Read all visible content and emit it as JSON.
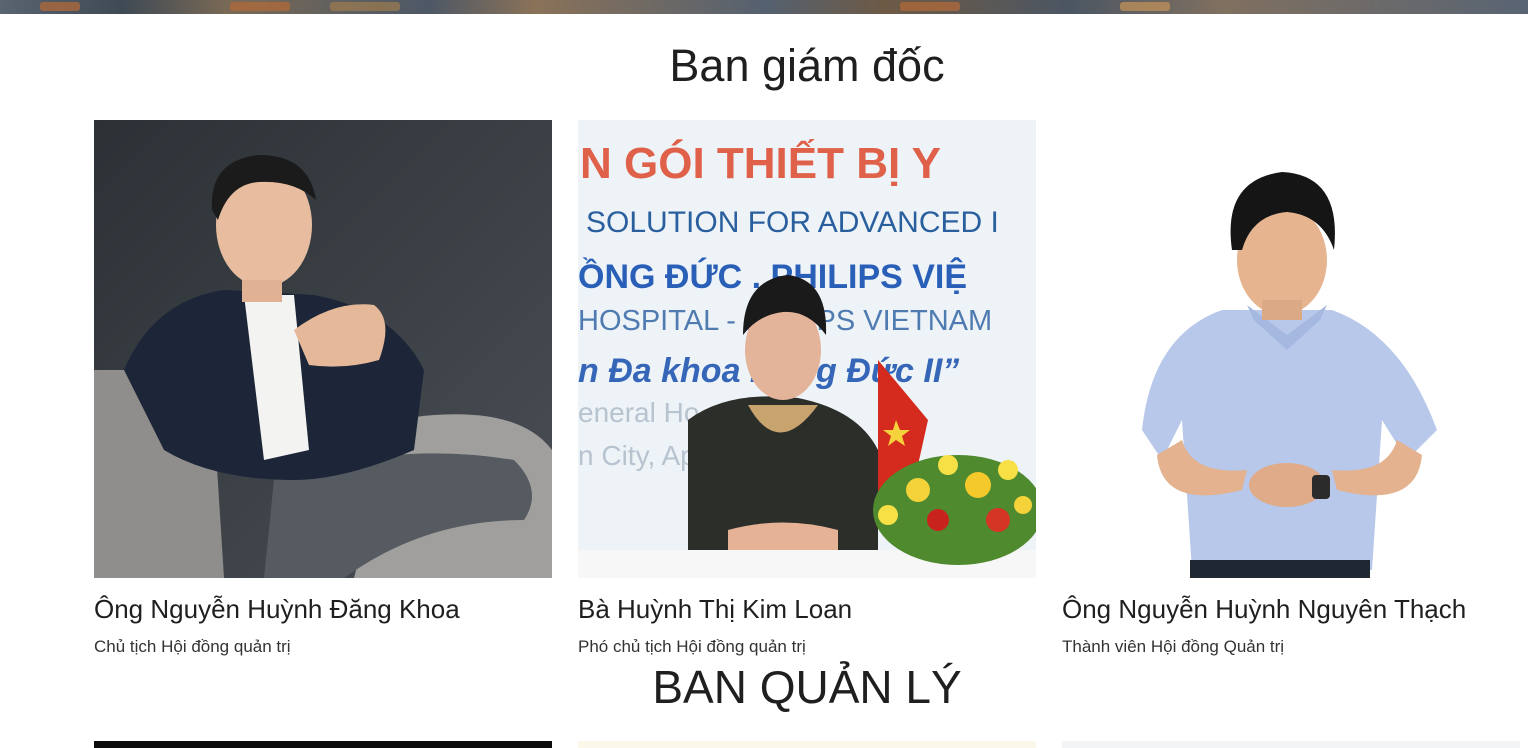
{
  "sections": {
    "directors_title": "Ban giám đốc",
    "management_title": "BAN QUẢN LÝ"
  },
  "directors": [
    {
      "name": "Ông Nguyễn Huỳnh Đăng Khoa",
      "role": "Chủ tịch Hội đồng quản trị"
    },
    {
      "name": "Bà Huỳnh Thị Kim Loan",
      "role": "Phó chủ tịch Hội đồng quản trị"
    },
    {
      "name": "Ông Nguyễn Huỳnh Nguyên Thạch",
      "role": "Thành viên Hội đồng Quản trị"
    }
  ],
  "photo2_banner": {
    "line1": "N GÓI THIẾT BỊ Y",
    "line2": "SOLUTION FOR ADVANCED I",
    "line3": "ỒNG ĐỨC . PHILIPS VIỆ",
    "line4": "HOSPITAL - PHILIPS VIETNAM",
    "line5": "n Đa khoa Hồng Đức II”",
    "line6": "eneral Ho",
    "line7": "n City, Ap"
  }
}
